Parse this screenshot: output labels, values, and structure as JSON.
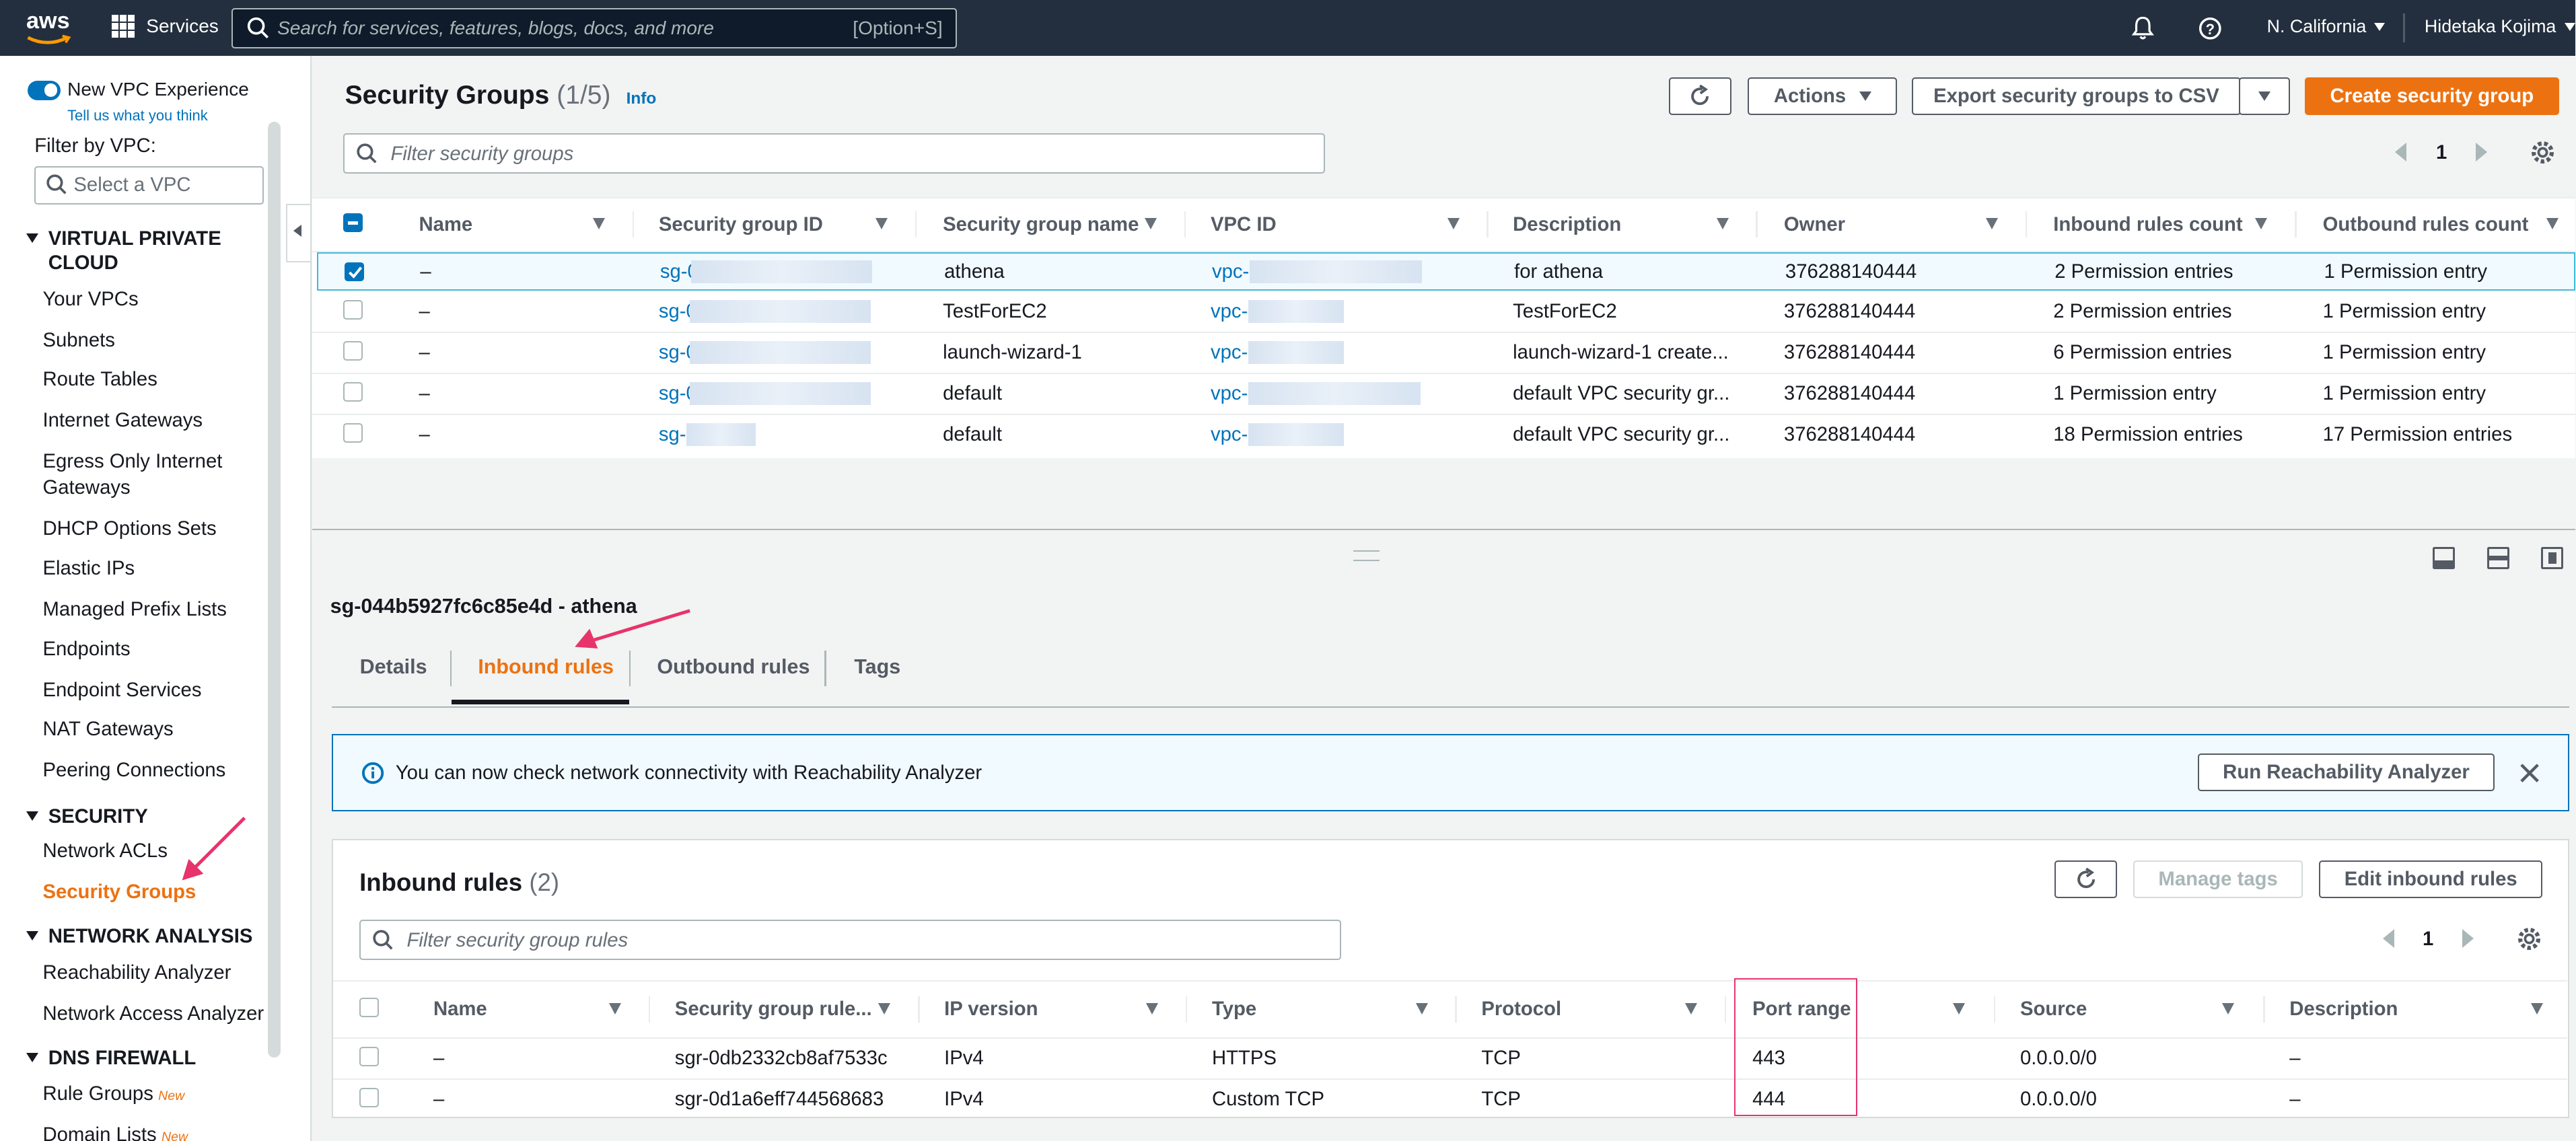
{
  "topnav": {
    "logo": "aws",
    "services": "Services",
    "search_placeholder": "Search for services, features, blogs, docs, and more",
    "search_shortcut": "[Option+S]",
    "region": "N. California",
    "user": "Hidetaka Kojima"
  },
  "sidebar": {
    "new_vpc": "New VPC Experience",
    "feedback": "Tell us what you think",
    "filter_label": "Filter by VPC:",
    "filter_placeholder": "Select a VPC",
    "sections": {
      "vpc": "VIRTUAL PRIVATE CLOUD",
      "security": "SECURITY",
      "network_analysis": "NETWORK ANALYSIS",
      "dns_firewall": "DNS FIREWALL"
    },
    "items": {
      "your_vpcs": "Your VPCs",
      "subnets": "Subnets",
      "route_tables": "Route Tables",
      "internet_gateways": "Internet Gateways",
      "egress": "Egress Only Internet Gateways",
      "dhcp": "DHCP Options Sets",
      "elastic_ips": "Elastic IPs",
      "prefix_lists": "Managed Prefix Lists",
      "endpoints": "Endpoints",
      "endpoint_services": "Endpoint Services",
      "nat_gateways": "NAT Gateways",
      "peering": "Peering Connections",
      "network_acls": "Network ACLs",
      "security_groups": "Security Groups",
      "reachability": "Reachability Analyzer",
      "network_access": "Network Access Analyzer",
      "rule_groups": "Rule Groups",
      "domain_lists": "Domain Lists"
    },
    "new_badge": "New"
  },
  "sg_list": {
    "title": "Security Groups",
    "count": "(1/5)",
    "info": "Info",
    "refresh": "refresh",
    "actions": "Actions",
    "export": "Export security groups to CSV",
    "create": "Create security group",
    "filter_placeholder": "Filter security groups",
    "page": "1",
    "columns": {
      "name": "Name",
      "id": "Security group ID",
      "group_name": "Security group name",
      "vpc": "VPC ID",
      "description": "Description",
      "owner": "Owner",
      "inbound": "Inbound rules count",
      "outbound": "Outbound rules count"
    },
    "rows": [
      {
        "name": "–",
        "id": "sg-0",
        "group_name": "athena",
        "vpc": "vpc-",
        "description": "for athena",
        "owner": "376288140444",
        "inbound": "2 Permission entries",
        "outbound": "1 Permission entry"
      },
      {
        "name": "–",
        "id": "sg-0",
        "group_name": "TestForEC2",
        "vpc": "vpc-",
        "description": "TestForEC2",
        "owner": "376288140444",
        "inbound": "2 Permission entries",
        "outbound": "1 Permission entry"
      },
      {
        "name": "–",
        "id": "sg-0",
        "group_name": "launch-wizard-1",
        "vpc": "vpc-",
        "description": "launch-wizard-1 create...",
        "owner": "376288140444",
        "inbound": "6 Permission entries",
        "outbound": "1 Permission entry"
      },
      {
        "name": "–",
        "id": "sg-0",
        "group_name": "default",
        "vpc": "vpc-",
        "description": "default VPC security gr...",
        "owner": "376288140444",
        "inbound": "1 Permission entry",
        "outbound": "1 Permission entry"
      },
      {
        "name": "–",
        "id": "sg-",
        "group_name": "default",
        "vpc": "vpc-",
        "description": "default VPC security gr...",
        "owner": "376288140444",
        "inbound": "18 Permission entries",
        "outbound": "17 Permission entries"
      }
    ]
  },
  "detail": {
    "title": "sg-044b5927fc6c85e4d - athena",
    "tabs": {
      "details": "Details",
      "inbound": "Inbound rules",
      "outbound": "Outbound rules",
      "tags": "Tags"
    },
    "banner_text": "You can now check network connectivity with Reachability Analyzer",
    "banner_button": "Run Reachability Analyzer",
    "rules_title": "Inbound rules",
    "rules_count": "(2)",
    "manage_tags": "Manage tags",
    "edit_rules": "Edit inbound rules",
    "rules_filter_placeholder": "Filter security group rules",
    "page": "1",
    "columns": {
      "name": "Name",
      "rule_id": "Security group rule...",
      "ip_version": "IP version",
      "type": "Type",
      "protocol": "Protocol",
      "port_range": "Port range",
      "source": "Source",
      "description": "Description"
    },
    "rules": [
      {
        "name": "–",
        "rule_id": "sgr-0db2332cb8af7533c",
        "ip_version": "IPv4",
        "type": "HTTPS",
        "protocol": "TCP",
        "port_range": "443",
        "source": "0.0.0.0/0",
        "description": "–"
      },
      {
        "name": "–",
        "rule_id": "sgr-0d1a6eff744568683",
        "ip_version": "IPv4",
        "type": "Custom TCP",
        "protocol": "TCP",
        "port_range": "444",
        "source": "0.0.0.0/0",
        "description": "–"
      }
    ]
  },
  "colors": {
    "nav": "#232f3e",
    "accent": "#ec7211",
    "link": "#0073bb",
    "annotation": "#e8336b"
  }
}
